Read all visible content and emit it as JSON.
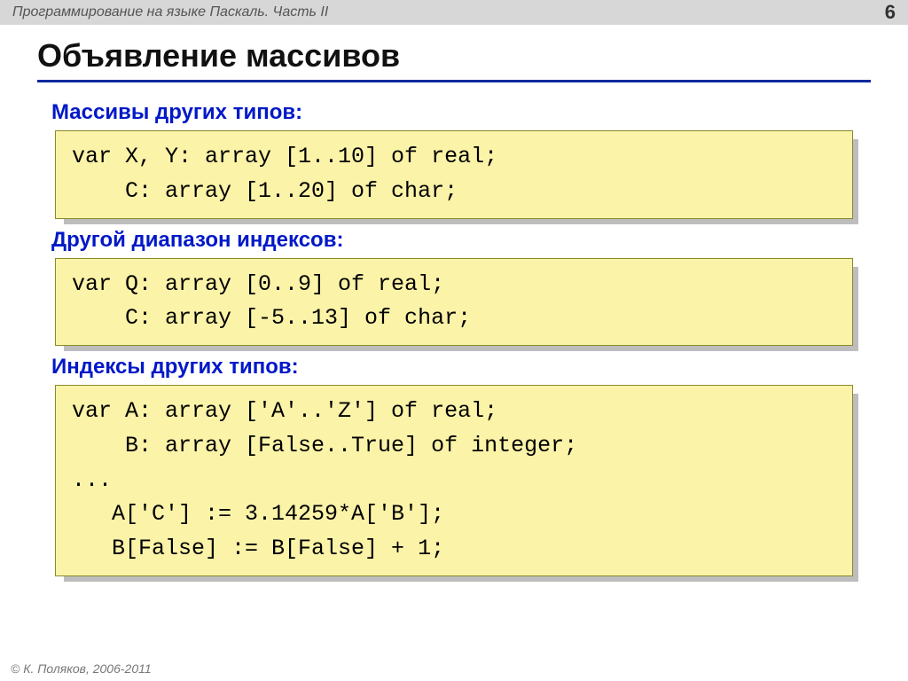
{
  "header": {
    "title_left": "Программирование на языке Паскаль. Часть II",
    "page_number": "6"
  },
  "title": "Объявление массивов",
  "sections": [
    {
      "heading": "Массивы других типов:",
      "code": "var X, Y: array [1..10] of real;\n    C: array [1..20] of char;"
    },
    {
      "heading": "Другой диапазон индексов:",
      "code": "var Q: array [0..9] of real;\n    C: array [-5..13] of char;"
    },
    {
      "heading": "Индексы других типов:",
      "code": "var A: array ['A'..'Z'] of real;\n    B: array [False..True] of integer;\n...\n   A['C'] := 3.14259*A['B'];\n   B[False] := B[False] + 1;"
    }
  ],
  "footer": "К. Поляков, 2006-2011",
  "copyright_symbol": "©"
}
